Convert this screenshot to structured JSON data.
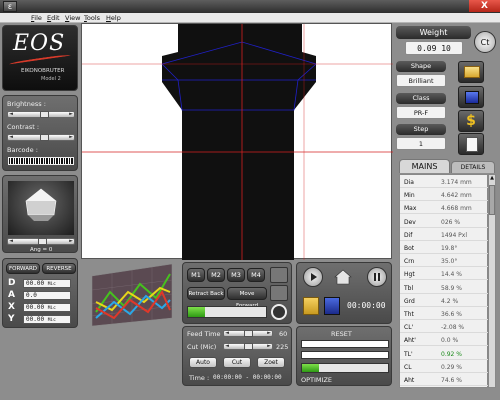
{
  "window": {
    "icon_glyph": "ε",
    "close_glyph": "X"
  },
  "menu": [
    {
      "underline": "F",
      "rest": "ile"
    },
    {
      "underline": "E",
      "rest": "dit"
    },
    {
      "underline": "V",
      "rest": "iew"
    },
    {
      "underline": "T",
      "rest": "ools"
    },
    {
      "underline": "H",
      "rest": "elp"
    }
  ],
  "logo": {
    "name": "EOS",
    "subtitle": "EIKONOBRUTER",
    "model": "Model 2"
  },
  "adjust": {
    "brightness_label": "Brightness :",
    "brightness_value": 55,
    "contrast_label": "Contrast :",
    "contrast_value": 55,
    "barcode_label": "Barcode :"
  },
  "preview": {
    "angle_label": "Ang = 0"
  },
  "motion": {
    "forward_label": "FORWARD",
    "reverse_label": "REVERSE",
    "rows": [
      {
        "letter": "D",
        "value": "00.00",
        "unit": "Mic"
      },
      {
        "letter": "A",
        "value": "0.0",
        "unit": ""
      },
      {
        "letter": "X",
        "value": "00.00",
        "unit": "Mic"
      },
      {
        "letter": "Y",
        "value": "00.00",
        "unit": "Mic"
      }
    ]
  },
  "memory": {
    "buttons": [
      "M1",
      "M2",
      "M3",
      "M4"
    ],
    "retract_label": "Retract Back",
    "move_forward_label": "Move Forward"
  },
  "playback": {
    "timer": "00:00:00"
  },
  "feed": {
    "feed_time_label": "Feed Time",
    "feed_time_value": "60",
    "cut_label": "Cut (Mic)",
    "cut_value": "225",
    "auto_label": "Auto",
    "cut_button": "Cut",
    "zoet_label": "Zoet",
    "time_label": "Time :",
    "time_value": "00:00:00 - 00:00:00"
  },
  "reset": {
    "reset_label": "RESET",
    "optimize_label": "OPTIMIZE"
  },
  "weight": {
    "label": "Weight",
    "value": "0.09 10",
    "unit_button": "Ct"
  },
  "shape": {
    "label": "Shape",
    "value": "Brilliant"
  },
  "class": {
    "label": "Class",
    "value": "PR-F"
  },
  "step": {
    "label": "Step",
    "value": "1"
  },
  "tabs": [
    {
      "label": "MAINS"
    },
    {
      "label": "DETAILS"
    }
  ],
  "measurements": [
    {
      "key": "Dia",
      "value": "3.174 mm"
    },
    {
      "key": "Min",
      "value": "4.642 mm"
    },
    {
      "key": "Max",
      "value": "4.668 mm"
    },
    {
      "key": "Dev",
      "value": "026 %"
    },
    {
      "key": "Dif",
      "value": "1494 Pxl"
    },
    {
      "key": "Bot",
      "value": "19.8°"
    },
    {
      "key": "Crn",
      "value": "35.0°"
    },
    {
      "key": "Hgt",
      "value": "14.4 %"
    },
    {
      "key": "Tbl",
      "value": "58.9 %"
    },
    {
      "key": "Grd",
      "value": "4.2 %"
    },
    {
      "key": "Tht",
      "value": "36.6 %"
    },
    {
      "key": "CL'",
      "value": "-2.08 %"
    },
    {
      "key": "Aht'",
      "value": "0.0 %"
    },
    {
      "key": "TL'",
      "value": "0.92 %",
      "color": "#1a8a1a"
    },
    {
      "key": "CL",
      "value": "0.29 %"
    },
    {
      "key": "Aht",
      "value": "74.6 %"
    }
  ],
  "colors": {
    "accent_green": "#46c21e",
    "crosshair": "#d42020",
    "outline": "#2020c8",
    "brand_red": "#d63a2a"
  }
}
